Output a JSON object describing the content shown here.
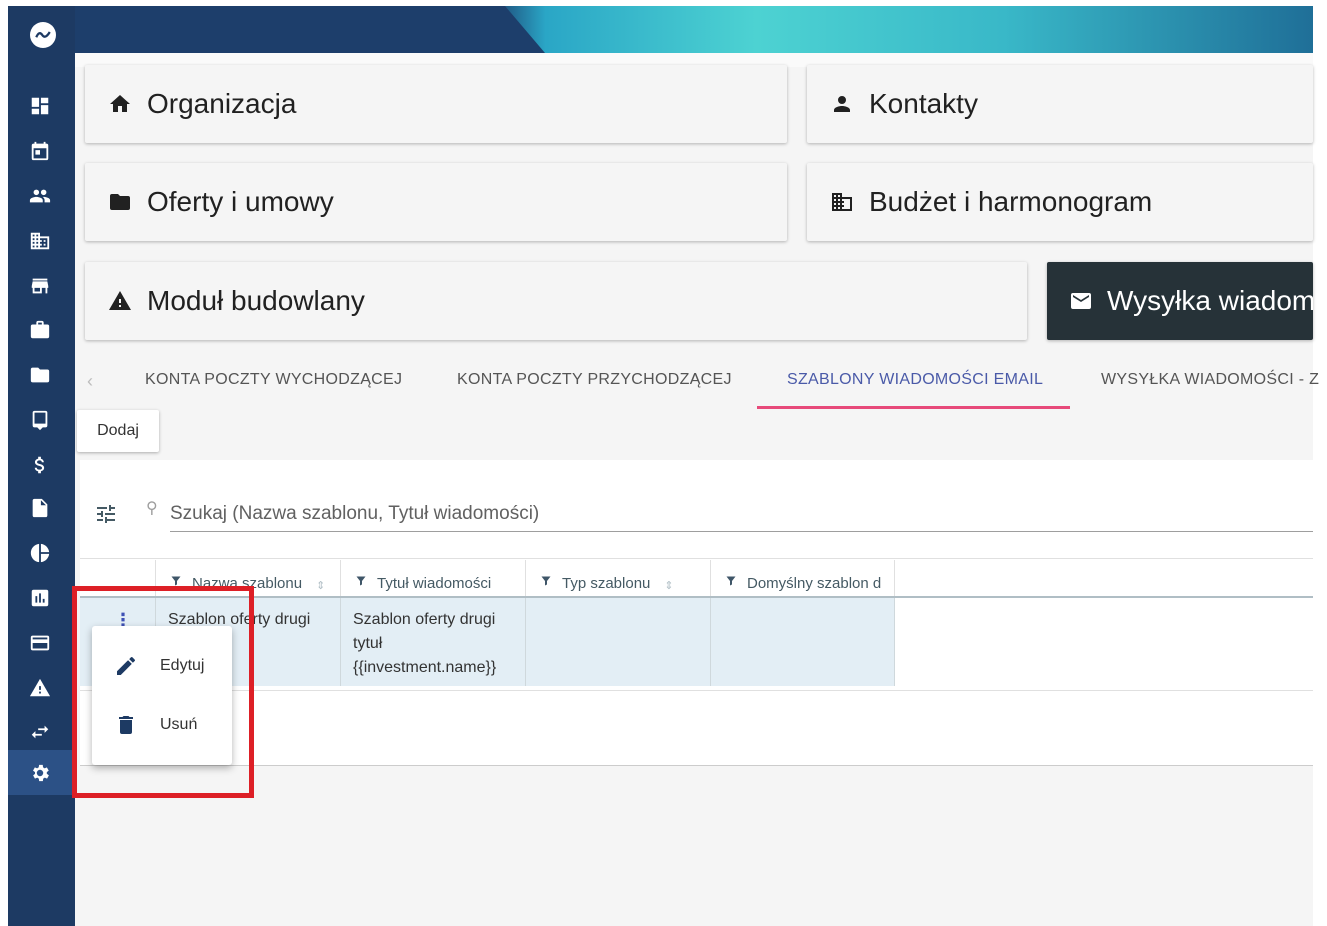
{
  "modules": [
    {
      "label": "Organizacja",
      "icon": "home-icon"
    },
    {
      "label": "Kontakty",
      "icon": "person-icon"
    },
    {
      "label": "Oferty i umowy",
      "icon": "folder-icon"
    },
    {
      "label": "Budżet i harmonogram",
      "icon": "building-icon"
    },
    {
      "label": "Moduł budowlany",
      "icon": "warning-icon"
    },
    {
      "label": "Wysyłka wiadom",
      "icon": "mail-icon"
    }
  ],
  "tabs": [
    {
      "label": "KONTA POCZTY WYCHODZĄCEJ"
    },
    {
      "label": "KONTA POCZTY PRZYCHODZĄCEJ"
    },
    {
      "label": "SZABLONY WIADOMOŚCI EMAIL"
    },
    {
      "label": "WYSYŁKA WIADOMOŚCI - Z"
    }
  ],
  "active_tab": "SZABLONY WIADOMOŚCI EMAIL",
  "add_button_label": "Dodaj",
  "search": {
    "placeholder": "Szukaj (Nazwa szablonu, Tytuł wiadomości)"
  },
  "table": {
    "columns": [
      "Nazwa szablonu",
      "Tytuł wiadomości",
      "Typ szablonu",
      "Domyślny szablon d"
    ],
    "rows": [
      {
        "name": "Szablon oferty drugi",
        "title_line1": "Szablon oferty drugi",
        "title_line2": "tytuł",
        "title_line3": "{{investment.name}}",
        "type": "",
        "default": ""
      }
    ]
  },
  "context_menu": {
    "edit": "Edytuj",
    "delete": "Usuń"
  },
  "colors": {
    "sidebar": "#1d3a63",
    "tab_active": "#4a5aa8",
    "tab_ink": "#e74a7a",
    "highlight": "#dd1f26"
  }
}
